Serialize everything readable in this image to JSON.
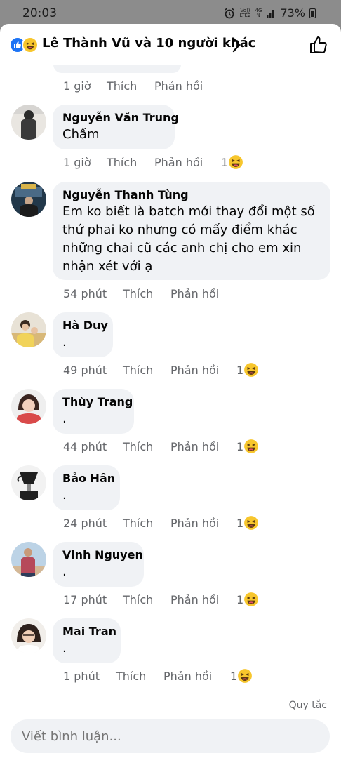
{
  "status_bar": {
    "time": "20:03",
    "net1_top": "Vo))",
    "net1_bottom": "LTE2",
    "net2": "4G",
    "battery": "73%"
  },
  "header": {
    "title": "Lê Thành Vũ và 10 người khác"
  },
  "comments": [
    {
      "time": "1 giờ",
      "like": "Thích",
      "reply": "Phản hồi"
    },
    {
      "name": "Nguyễn Văn Trung",
      "text": "Chấm",
      "time": "1 giờ",
      "like": "Thích",
      "reply": "Phản hồi",
      "reaction_count": "1"
    },
    {
      "name": "Nguyễn Thanh Tùng",
      "text": "Em ko biết là batch mới thay đổi một số thứ phai ko nhưng có mấy điểm khác những chai cũ các anh chị cho em xin nhận xét với ạ",
      "time": "54 phút",
      "like": "Thích",
      "reply": "Phản hồi"
    },
    {
      "name": "Hà Duy",
      "text": ".",
      "time": "49 phút",
      "like": "Thích",
      "reply": "Phản hồi",
      "reaction_count": "1"
    },
    {
      "name": "Thùy Trang",
      "text": ".",
      "time": "44 phút",
      "like": "Thích",
      "reply": "Phản hồi",
      "reaction_count": "1"
    },
    {
      "name": "Bảo Hân",
      "text": ".",
      "time": "24 phút",
      "like": "Thích",
      "reply": "Phản hồi",
      "reaction_count": "1"
    },
    {
      "name": "Vinh Nguyen",
      "text": ".",
      "time": "17 phút",
      "like": "Thích",
      "reply": "Phản hồi",
      "reaction_count": "1"
    },
    {
      "name": "Mai Tran",
      "text": ".",
      "time": "1 phút",
      "like": "Thích",
      "reply": "Phản hồi",
      "reaction_count": "1"
    }
  ],
  "footer": {
    "rules": "Quy tắc",
    "placeholder": "Viết bình luận..."
  },
  "colors": {
    "like_blue": "#1d74f5",
    "reaction_yellow": "#f7c62d",
    "bubble_bg": "#f0f2f5",
    "meta_gray": "#65676b"
  }
}
